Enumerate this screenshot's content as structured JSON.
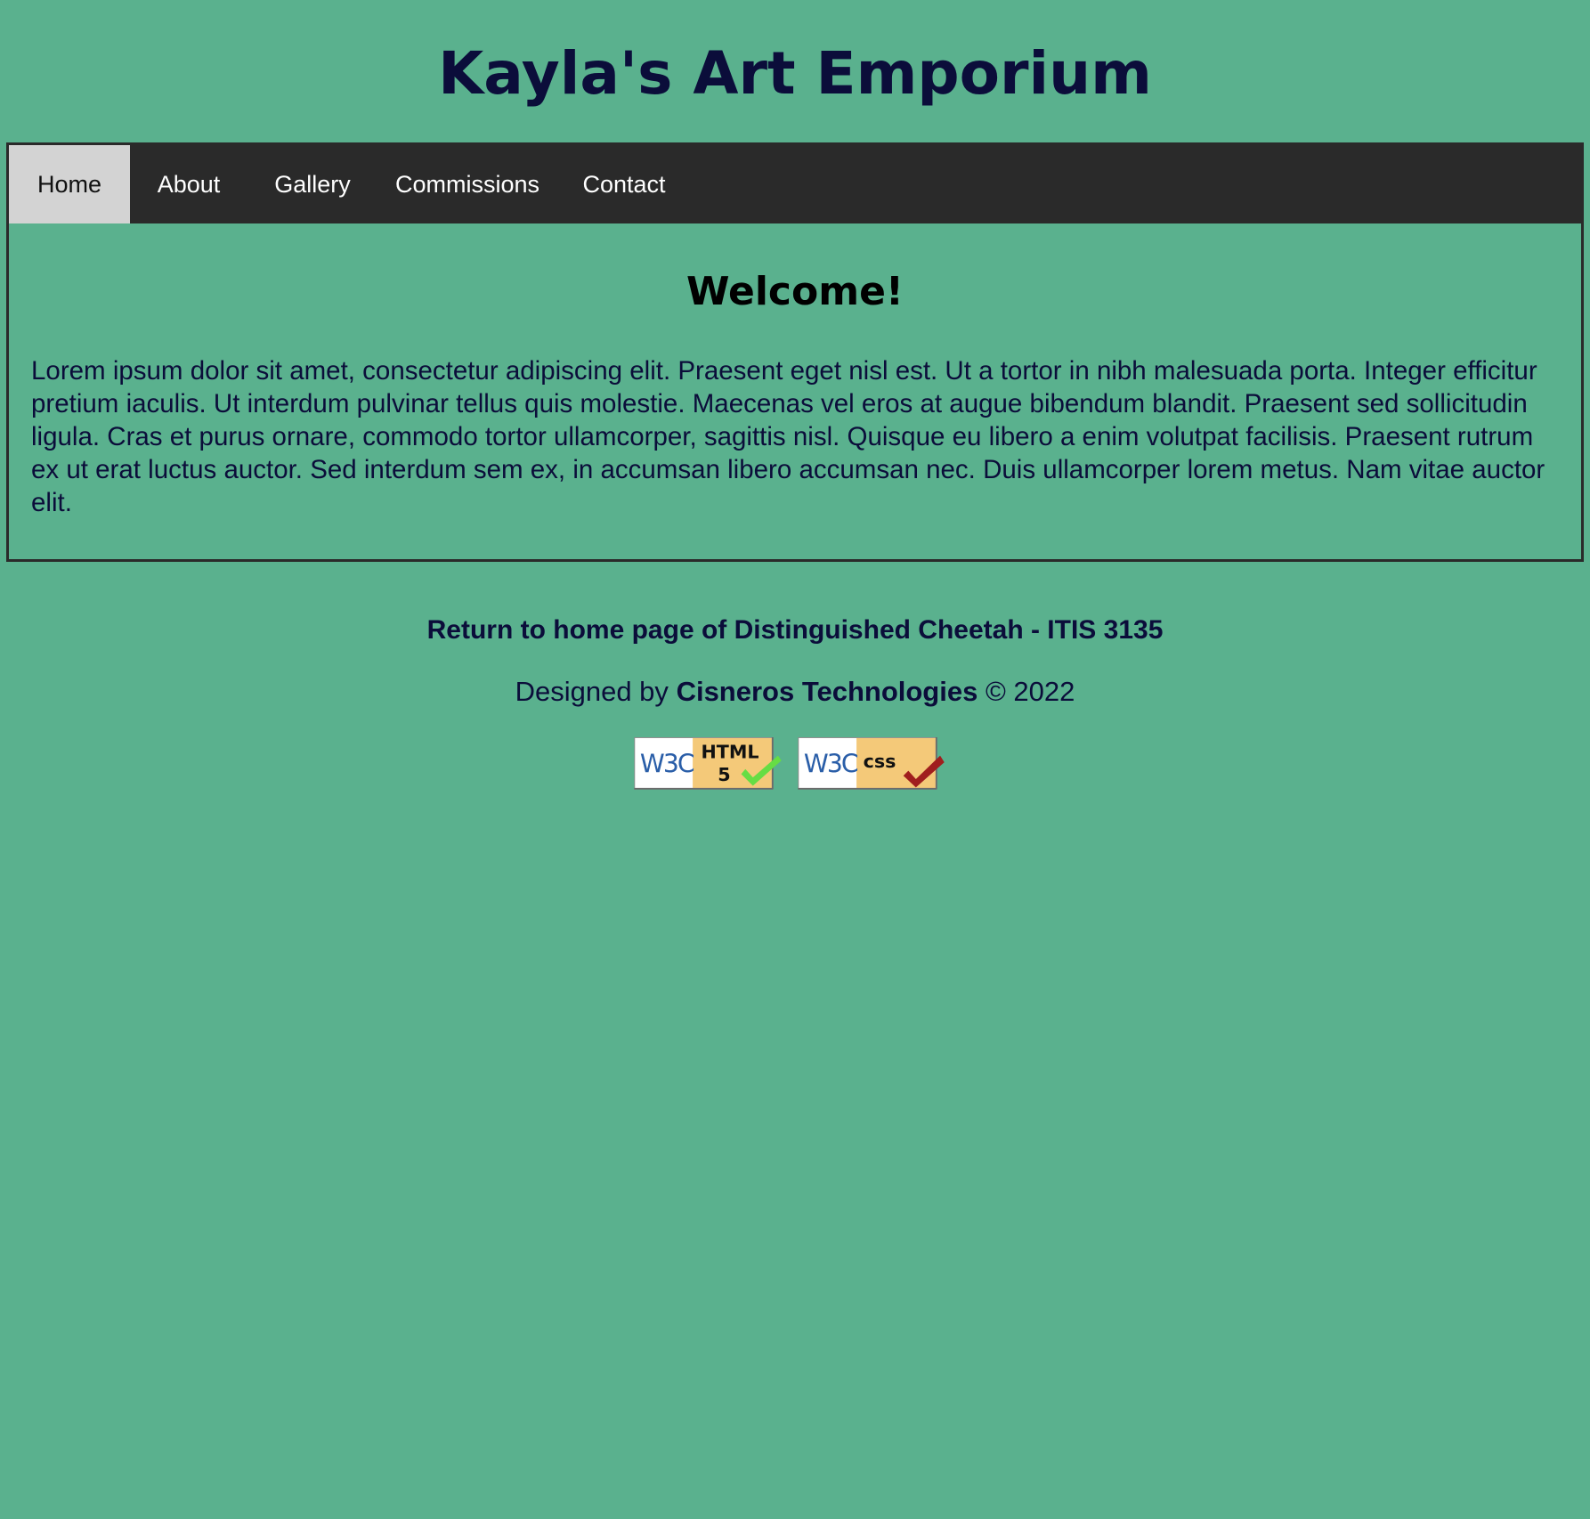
{
  "header": {
    "title": "Kayla's Art Emporium"
  },
  "nav": {
    "items": [
      {
        "label": "Home",
        "active": true
      },
      {
        "label": "About",
        "active": false
      },
      {
        "label": "Gallery",
        "active": false
      },
      {
        "label": "Commissions",
        "active": false
      },
      {
        "label": "Contact",
        "active": false
      }
    ]
  },
  "main": {
    "heading": "Welcome!",
    "paragraph": "Lorem ipsum dolor sit amet, consectetur adipiscing elit. Praesent eget nisl est. Ut a tortor in nibh malesuada porta. Integer efficitur pretium iaculis. Ut interdum pulvinar tellus quis molestie. Maecenas vel eros at augue bibendum blandit. Praesent sed sollicitudin ligula. Cras et purus ornare, commodo tortor ullamcorper, sagittis nisl. Quisque eu libero a enim volutpat facilisis. Praesent rutrum ex ut erat luctus auctor. Sed interdum sem ex, in accumsan libero accumsan nec. Duis ullamcorper lorem metus. Nam vitae auctor elit."
  },
  "footer": {
    "return_link": "Return to home page of Distinguished Cheetah - ITIS 3135",
    "designed_by_prefix": "Designed by",
    "company": "Cisneros Technologies",
    "copyright": "© 2022",
    "badges": [
      {
        "logo": "W3C",
        "label_line1": "HTML",
        "label_line2": "5",
        "check_color": "#66dd44"
      },
      {
        "logo": "W3C",
        "label_line1": "css",
        "label_line2": "",
        "check_color": "#a01e1e"
      }
    ]
  },
  "colors": {
    "background": "#5ab18e",
    "nav_background": "#2a2a2a",
    "nav_active": "#d3d3d3",
    "text_dark": "#0b0d3a",
    "badge_right": "#f4c979"
  }
}
